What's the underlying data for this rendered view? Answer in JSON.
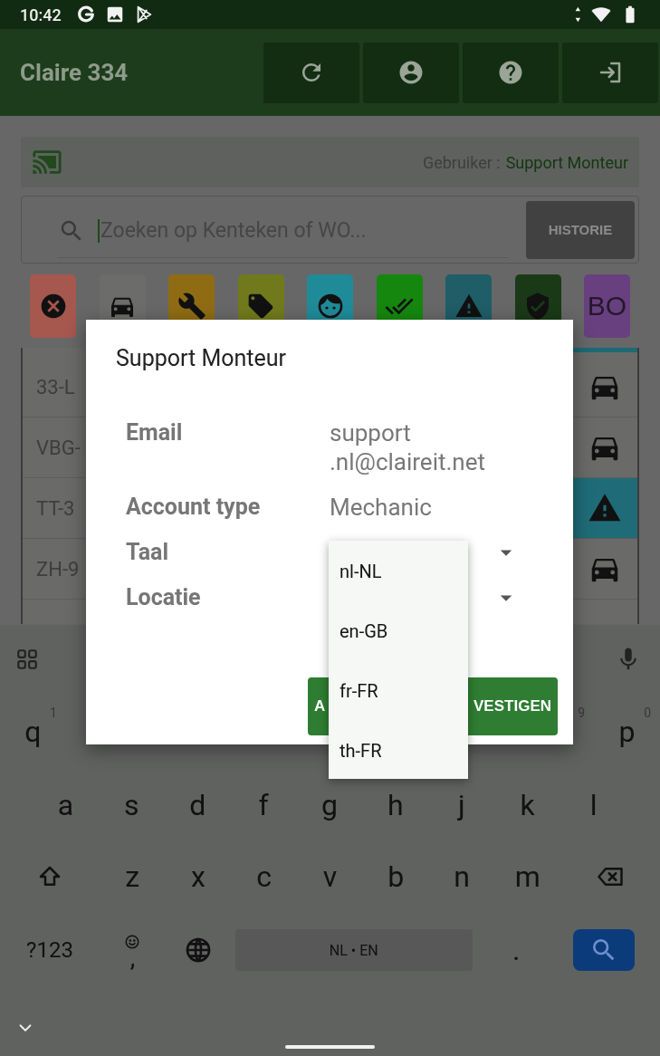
{
  "status_bar": {
    "time": "10:42"
  },
  "app_bar": {
    "title": "Claire 334"
  },
  "user_bar": {
    "label": "Gebruiker :",
    "user": "Support Monteur"
  },
  "search": {
    "placeholder": "Zoeken op Kenteken of WO...",
    "button": "HISTORIE"
  },
  "filters": [
    {
      "kind": "cancel",
      "color": "#a6574e"
    },
    {
      "kind": "car",
      "color": "#6c6c6b"
    },
    {
      "kind": "wrench",
      "color": "#8f6c14"
    },
    {
      "kind": "tag",
      "color": "#707a1d"
    },
    {
      "kind": "face",
      "color": "#1f8b98"
    },
    {
      "kind": "done",
      "color": "#15870f"
    },
    {
      "kind": "warning",
      "color": "#1f5d67"
    },
    {
      "kind": "shield",
      "color": "#1a3a17"
    },
    {
      "kind": "text",
      "label": "BO",
      "color": "#68407f"
    }
  ],
  "list": {
    "rows": [
      {
        "plate": "33-L",
        "kind": "car"
      },
      {
        "plate": "VBG-",
        "kind": "car"
      },
      {
        "plate": "TT-3",
        "kind": "warning"
      },
      {
        "plate": "ZH-9",
        "kind": "car"
      }
    ]
  },
  "dialog": {
    "title": "Support Monteur",
    "fields": [
      {
        "kind": "text",
        "label": "Email",
        "value": "support\n.nl@claireit.net"
      },
      {
        "kind": "text",
        "label": "Account type",
        "value": "Mechanic"
      },
      {
        "kind": "select",
        "label": "Taal"
      },
      {
        "kind": "select",
        "label": "Locatie"
      }
    ],
    "buttons": [
      "A",
      "VESTIGEN"
    ]
  },
  "dropdown": {
    "options": [
      "nl-NL",
      "en-GB",
      "fr-FR",
      "th-FR"
    ]
  },
  "keyboard": {
    "row_1": [
      {
        "label": "q",
        "hint": "1"
      },
      {
        "hint": "9"
      },
      {
        "label": "p",
        "hint": "0"
      }
    ],
    "row_2": [
      "a",
      "s",
      "d",
      "f",
      "g",
      "h",
      "j",
      "k",
      "l"
    ],
    "row_3": [
      "z",
      "x",
      "c",
      "v",
      "b",
      "n",
      "m"
    ],
    "symbols_key": "?123",
    "comma_key": ",",
    "space_key": "NL • EN",
    "period_key": "."
  }
}
